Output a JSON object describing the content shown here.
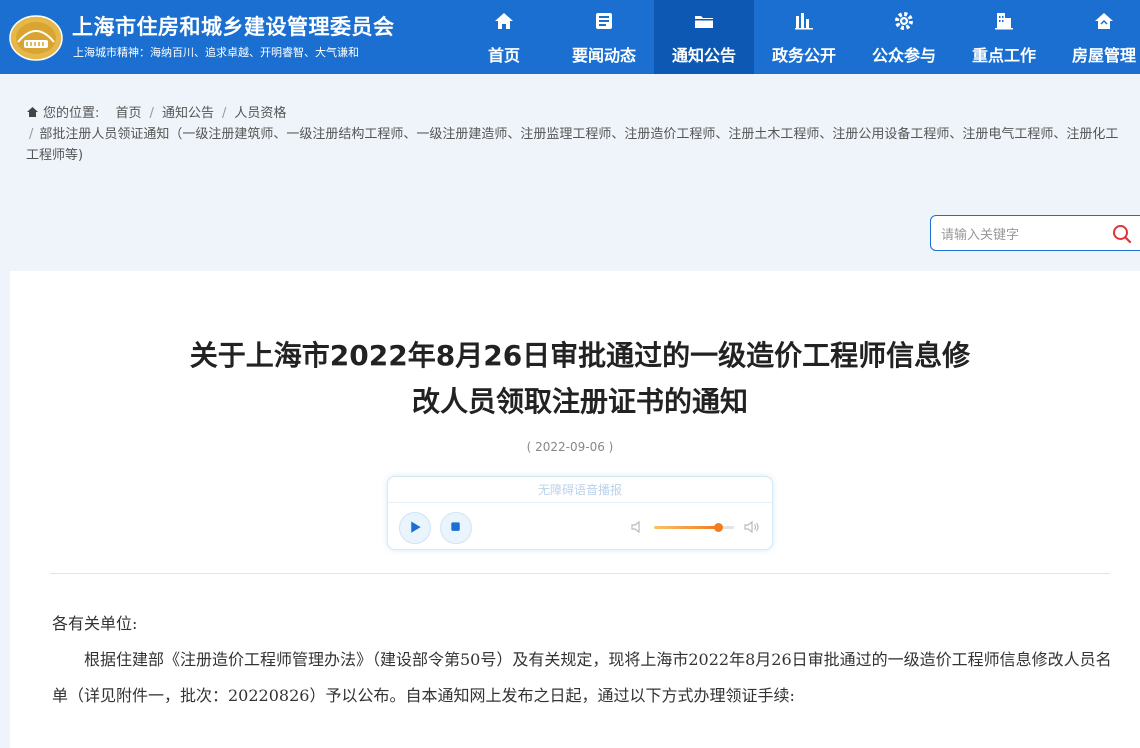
{
  "site": {
    "title": "上海市住房和城乡建设管理委员会",
    "motto": "上海城市精神：海纳百川、追求卓越、开明睿智、大气谦和"
  },
  "nav": {
    "items": [
      {
        "label": "首页",
        "icon": "home-icon"
      },
      {
        "label": "要闻动态",
        "icon": "news-icon"
      },
      {
        "label": "通知公告",
        "icon": "folder-icon",
        "active": true
      },
      {
        "label": "政务公开",
        "icon": "chart-icon"
      },
      {
        "label": "公众参与",
        "icon": "gear-icon"
      },
      {
        "label": "重点工作",
        "icon": "building-icon"
      },
      {
        "label": "房屋管理",
        "icon": "house-icon"
      }
    ]
  },
  "breadcrumb": {
    "prefix": "您的位置:",
    "items": [
      "首页",
      "通知公告",
      "人员资格",
      "部批注册人员领证通知（一级注册建筑师、一级注册结构工程师、一级注册建造师、注册监理工程师、注册造价工程师、注册土木工程师、注册公用设备工程师、注册电气工程师、注册化工工程师等)"
    ]
  },
  "search": {
    "placeholder": "请输入关键字"
  },
  "article": {
    "title_line1": "关于上海市2022年8月26日审批通过的一级造价工程师信息修",
    "title_line2": "改人员领取注册证书的通知",
    "date": "( 2022-09-06 )",
    "player_title": "无障碍语音播报",
    "volume": 0.8,
    "greeting": "各有关单位:",
    "paragraph1": "根据住建部《注册造价工程师管理办法》（建设部令第50号）及有关规定，现将上海市2022年8月26日审批通过的一级造价工程师信息修改人员名单（详见附件一，批次：20220826）予以公布。自本通知网上发布之日起，通过以下方式办理领证手续:"
  },
  "colors": {
    "brand": "#1a6fd1",
    "nav_active": "#0c58b3",
    "volume_accent": "#f07d1e"
  }
}
